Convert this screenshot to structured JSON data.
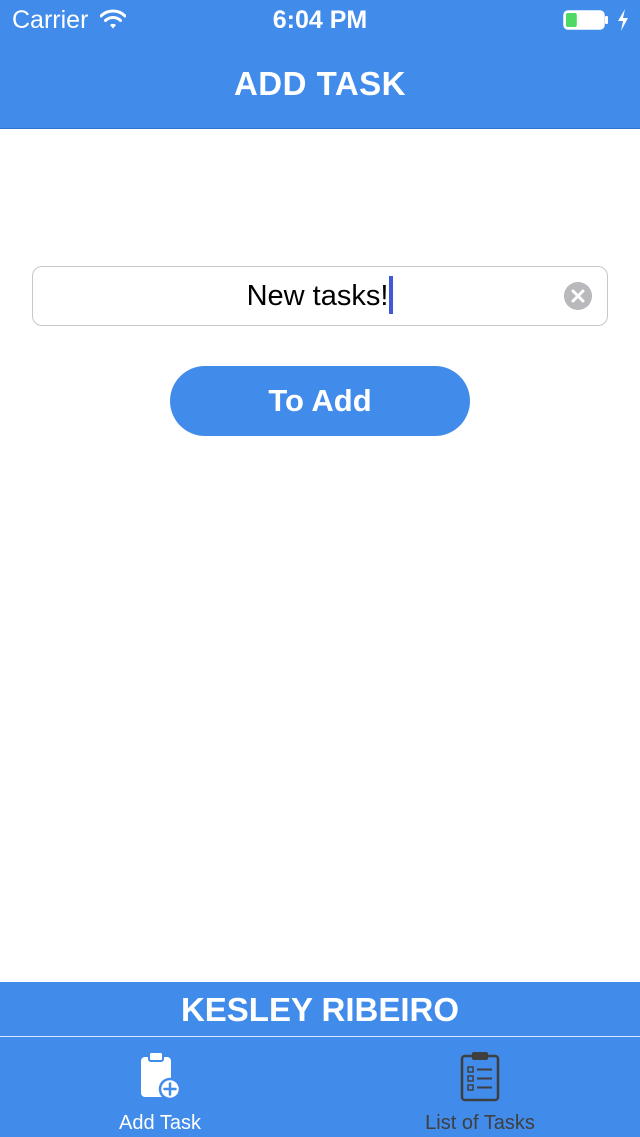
{
  "status_bar": {
    "carrier": "Carrier",
    "time": "6:04 PM",
    "battery_level": 0.3,
    "charging": true
  },
  "nav": {
    "title": "ADD TASK"
  },
  "form": {
    "task_value": "New tasks!",
    "add_button_label": "To Add"
  },
  "footer": {
    "author": "KESLEY RIBEIRO"
  },
  "tabs": [
    {
      "label": "Add Task",
      "icon": "clipboard-add-icon",
      "selected": true
    },
    {
      "label": "List of Tasks",
      "icon": "clipboard-list-icon",
      "selected": false
    }
  ],
  "colors": {
    "brand": "#418bea",
    "caret": "#3f5ad9",
    "battery_fill": "#4cd964",
    "inactive_tab": "#3f3f3f"
  }
}
